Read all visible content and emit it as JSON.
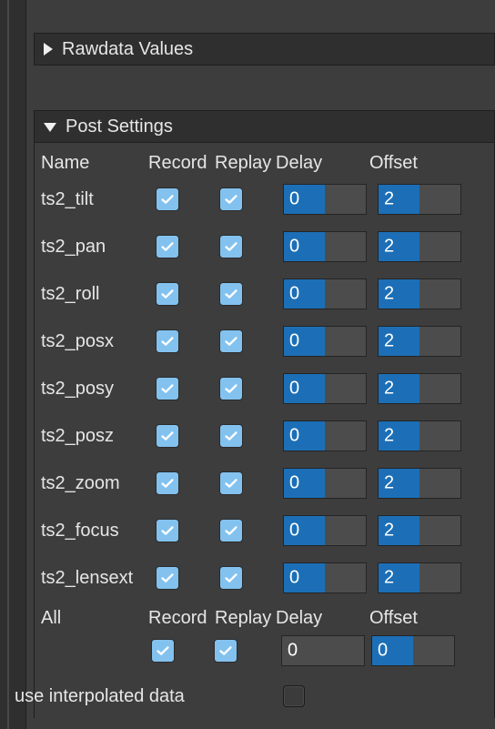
{
  "rawdata_panel": {
    "title": "Rawdata Values"
  },
  "post_panel": {
    "title": "Post Settings"
  },
  "table": {
    "headers": {
      "name": "Name",
      "record": "Record",
      "replay": "Replay",
      "delay": "Delay",
      "offset": "Offset"
    },
    "rows": [
      {
        "name": "ts2_tilt",
        "record": true,
        "replay": true,
        "delay": "0",
        "offset": "2"
      },
      {
        "name": "ts2_pan",
        "record": true,
        "replay": true,
        "delay": "0",
        "offset": "2"
      },
      {
        "name": "ts2_roll",
        "record": true,
        "replay": true,
        "delay": "0",
        "offset": "2"
      },
      {
        "name": "ts2_posx",
        "record": true,
        "replay": true,
        "delay": "0",
        "offset": "2"
      },
      {
        "name": "ts2_posy",
        "record": true,
        "replay": true,
        "delay": "0",
        "offset": "2"
      },
      {
        "name": "ts2_posz",
        "record": true,
        "replay": true,
        "delay": "0",
        "offset": "2"
      },
      {
        "name": "ts2_zoom",
        "record": true,
        "replay": true,
        "delay": "0",
        "offset": "2"
      },
      {
        "name": "ts2_focus",
        "record": true,
        "replay": true,
        "delay": "0",
        "offset": "2"
      },
      {
        "name": "ts2_lensext",
        "record": true,
        "replay": true,
        "delay": "0",
        "offset": "2"
      }
    ]
  },
  "all": {
    "label": "All",
    "headers": {
      "record": "Record",
      "replay": "Replay",
      "delay": "Delay",
      "offset": "Offset"
    },
    "record": true,
    "replay": true,
    "delay": "0",
    "offset": "0"
  },
  "options": {
    "use_interpolated_data_label": "use interpolated data",
    "use_interpolated_data_checked": false
  },
  "colors": {
    "accent_fill": "#1c6fb6",
    "checkbox_checked": "#83c2ef",
    "panel_header": "#2f2f2f",
    "background": "#3d3d3d"
  }
}
